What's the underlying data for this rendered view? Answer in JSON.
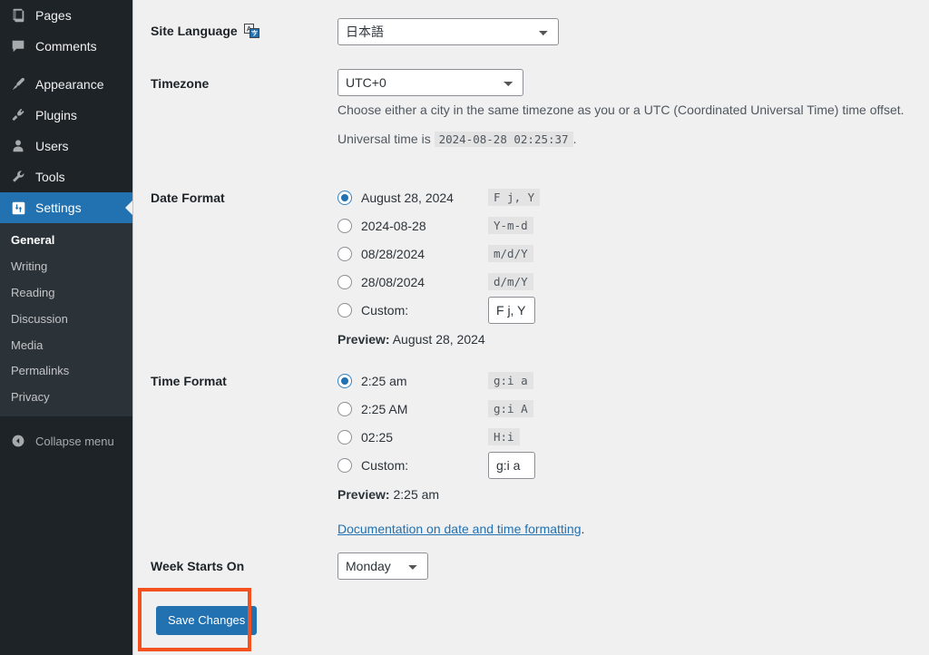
{
  "sidebar": {
    "items": [
      {
        "label": "Pages",
        "icon": "pages-icon"
      },
      {
        "label": "Comments",
        "icon": "comments-icon"
      },
      {
        "label": "Appearance",
        "icon": "appearance-icon"
      },
      {
        "label": "Plugins",
        "icon": "plugins-icon"
      },
      {
        "label": "Users",
        "icon": "users-icon"
      },
      {
        "label": "Tools",
        "icon": "tools-icon"
      },
      {
        "label": "Settings",
        "icon": "settings-icon"
      }
    ],
    "submenu": [
      {
        "label": "General",
        "active": true
      },
      {
        "label": "Writing",
        "active": false
      },
      {
        "label": "Reading",
        "active": false
      },
      {
        "label": "Discussion",
        "active": false
      },
      {
        "label": "Media",
        "active": false
      },
      {
        "label": "Permalinks",
        "active": false
      },
      {
        "label": "Privacy",
        "active": false
      }
    ],
    "collapse_label": "Collapse menu",
    "accent_color": "#2271b1",
    "background_color": "#1d2327",
    "submenu_background": "#2c3338"
  },
  "form": {
    "site_language": {
      "label": "Site Language",
      "icon": "translation-icon",
      "value": "日本語"
    },
    "timezone": {
      "label": "Timezone",
      "value": "UTC+0",
      "help": "Choose either a city in the same timezone as you or a UTC (Coordinated Universal Time) time offset.",
      "universal_prefix": "Universal time is",
      "universal_time": "2024-08-28 02:25:37",
      "universal_suffix": "."
    },
    "date_format": {
      "label": "Date Format",
      "options": [
        {
          "text": "August 28, 2024",
          "code": "F j, Y",
          "selected": true
        },
        {
          "text": "2024-08-28",
          "code": "Y-m-d",
          "selected": false
        },
        {
          "text": "08/28/2024",
          "code": "m/d/Y",
          "selected": false
        },
        {
          "text": "28/08/2024",
          "code": "d/m/Y",
          "selected": false
        }
      ],
      "custom_label": "Custom:",
      "custom_value": "F j, Y",
      "preview_label": "Preview:",
      "preview_value": "August 28, 2024"
    },
    "time_format": {
      "label": "Time Format",
      "options": [
        {
          "text": "2:25 am",
          "code": "g:i a",
          "selected": true
        },
        {
          "text": "2:25 AM",
          "code": "g:i A",
          "selected": false
        },
        {
          "text": "02:25",
          "code": "H:i",
          "selected": false
        }
      ],
      "custom_label": "Custom:",
      "custom_value": "g:i a",
      "preview_label": "Preview:",
      "preview_value": "2:25 am",
      "doc_link": "Documentation on date and time formatting",
      "doc_link_suffix": "."
    },
    "week_starts_on": {
      "label": "Week Starts On",
      "value": "Monday"
    }
  },
  "actions": {
    "save_label": "Save Changes",
    "highlight_color": "#f4511e"
  }
}
